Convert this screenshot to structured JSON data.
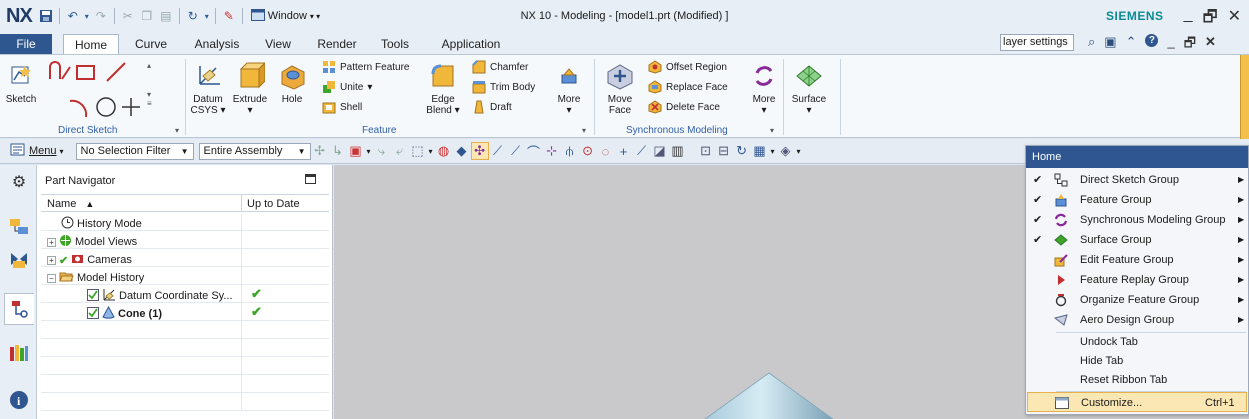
{
  "app": {
    "logo": "NX",
    "window_menu_label": "Window",
    "window_title": "NX 10 - Modeling - [model1.prt (Modified) ]",
    "brand": "SIEMENS"
  },
  "tabs": {
    "file": "File",
    "items": [
      "Home",
      "Curve",
      "Analysis",
      "View",
      "Render",
      "Tools",
      "Application"
    ],
    "active": "Home"
  },
  "search": {
    "value": "layer settings"
  },
  "ribbon": {
    "direct_sketch": {
      "sketch_label": "Sketch",
      "group_label": "Direct Sketch"
    },
    "feature": {
      "datum_label": "Datum",
      "datum_sub": "CSYS",
      "extrude_label": "Extrude",
      "hole_label": "Hole",
      "pattern_feature": "Pattern Feature",
      "unite": "Unite",
      "shell": "Shell",
      "edge_blend_1": "Edge",
      "edge_blend_2": "Blend",
      "chamfer": "Chamfer",
      "trim_body": "Trim Body",
      "draft": "Draft",
      "more": "More",
      "group_label": "Feature"
    },
    "synchronous": {
      "move_face_1": "Move",
      "move_face_2": "Face",
      "offset_region": "Offset Region",
      "replace_face": "Replace Face",
      "delete_face": "Delete Face",
      "more": "More",
      "group_label": "Synchronous Modeling"
    },
    "surface": {
      "label": "Surface"
    }
  },
  "toolbar": {
    "menu_label": "Menu",
    "selection_filter": "No Selection Filter",
    "scope": "Entire Assembly"
  },
  "navigator": {
    "title": "Part Navigator",
    "columns": [
      "Name",
      "Up to Date"
    ],
    "rows": [
      {
        "name": "History Mode",
        "up_to_date": false
      },
      {
        "name": "Model Views",
        "up_to_date": false
      },
      {
        "name": "Cameras",
        "up_to_date": false
      },
      {
        "name": "Model History",
        "up_to_date": false
      },
      {
        "name": "Datum Coordinate Sy...",
        "up_to_date": true
      },
      {
        "name": "Cone (1)",
        "up_to_date": true
      }
    ]
  },
  "context_menu": {
    "title": "Home",
    "items": [
      {
        "label": "Direct Sketch Group",
        "checked": true,
        "submenu": true,
        "icon": "sketch-icon"
      },
      {
        "label": "Feature Group",
        "checked": true,
        "submenu": true,
        "icon": "feature-icon"
      },
      {
        "label": "Synchronous Modeling Group",
        "checked": true,
        "submenu": true,
        "icon": "sync-icon"
      },
      {
        "label": "Surface Group",
        "checked": true,
        "submenu": true,
        "icon": "surface-icon"
      },
      {
        "label": "Edit Feature Group",
        "checked": false,
        "submenu": true,
        "icon": "edit-feature-icon"
      },
      {
        "label": "Feature Replay Group",
        "checked": false,
        "submenu": true,
        "icon": "replay-icon"
      },
      {
        "label": "Organize Feature Group",
        "checked": false,
        "submenu": true,
        "icon": "organize-icon"
      },
      {
        "label": "Aero Design Group",
        "checked": false,
        "submenu": true,
        "icon": "aero-icon"
      }
    ],
    "actions": [
      "Undock Tab",
      "Hide Tab",
      "Reset Ribbon Tab"
    ],
    "customize": {
      "label": "Customize...",
      "shortcut": "Ctrl+1"
    }
  },
  "colors": {
    "accent": "#2f5690",
    "check_green": "#3ea529",
    "viewport": "#c9c9cb",
    "highlight": "#fbe7b3"
  }
}
